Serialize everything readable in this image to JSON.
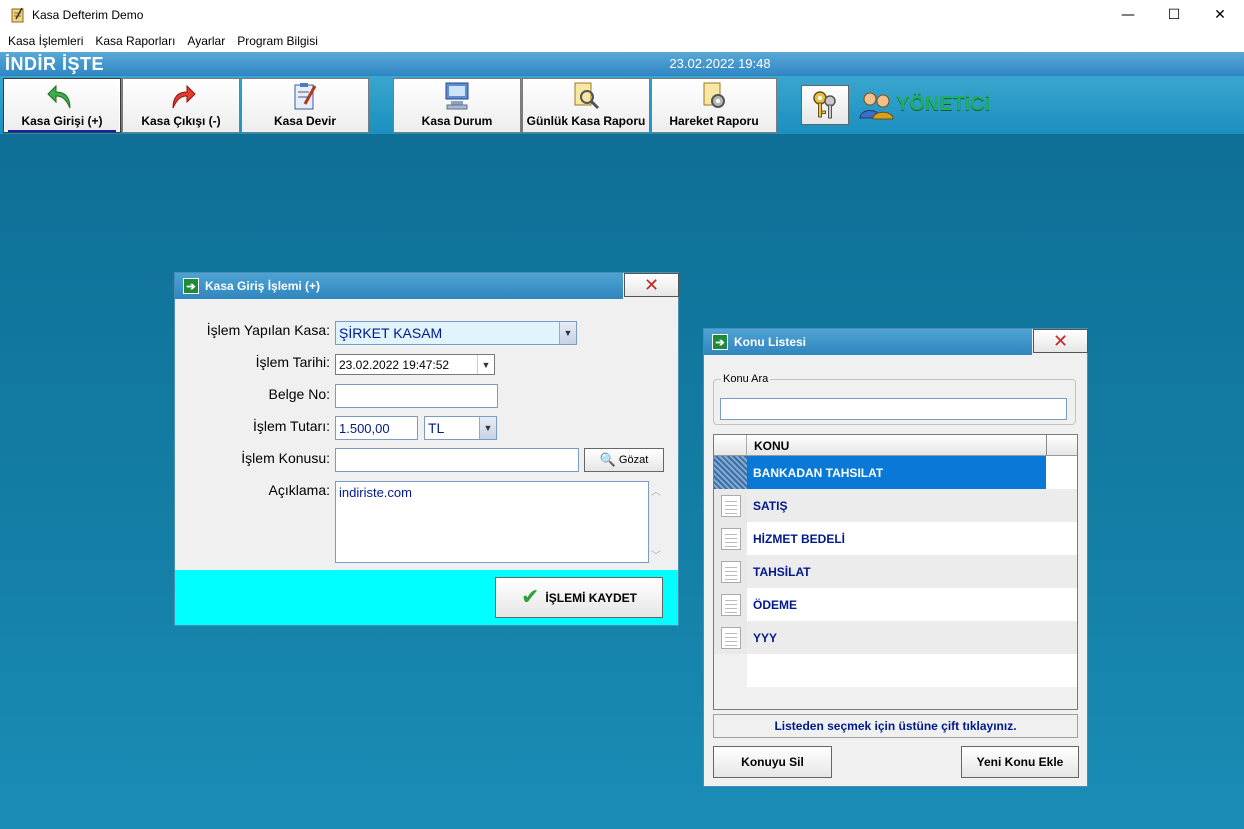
{
  "window": {
    "title": "Kasa Defterim Demo",
    "minimize": "—",
    "maximize": "☐",
    "close": "✕"
  },
  "menu": [
    "Kasa İşlemleri",
    "Kasa Raporları",
    "Ayarlar",
    "Program Bilgisi"
  ],
  "header": {
    "brand": "İNDİR İŞTE",
    "datetime": "23.02.2022 19:48"
  },
  "toolbar": {
    "kasa_girisi": "Kasa Girişi  (+)",
    "kasa_cikisi": "Kasa Çıkışı (-)",
    "kasa_devir": "Kasa Devir",
    "kasa_durum": "Kasa Durum",
    "gunluk_rapor": "Günlük Kasa Raporu",
    "hareket_raporu": "Hareket Raporu",
    "user_role": "YÖNETiCi"
  },
  "kasa_giris": {
    "title": "Kasa Giriş İşlemi (+)",
    "labels": {
      "kasa": "İşlem Yapılan Kasa:",
      "tarih": "İşlem Tarihi:",
      "belge": "Belge No:",
      "tutar": "İşlem Tutarı:",
      "konu": "İşlem Konusu:",
      "aciklama": "Açıklama:"
    },
    "values": {
      "kasa": "ŞİRKET KASAM",
      "tarih": "23.02.2022 19:47:52",
      "belge": "",
      "tutar": "1.500,00",
      "currency": "TL",
      "konu": "",
      "aciklama": "indiriste.com"
    },
    "browse_label": "Gözat",
    "save_label": "İŞLEMİ KAYDET"
  },
  "konu_listesi": {
    "title": "Konu Listesi",
    "search_legend": "Konu Ara",
    "search_value": "",
    "column": "KONU",
    "rows": [
      "BANKADAN TAHSILAT",
      "SATIŞ",
      "HİZMET BEDELİ",
      "TAHSİLAT",
      "ÖDEME",
      "YYY"
    ],
    "selected_index": 0,
    "hint": "Listeden seçmek için üstüne çift tıklayınız.",
    "delete_label": "Konuyu Sil",
    "add_label": "Yeni Konu Ekle"
  },
  "colors": {
    "workspace": "#147fa6",
    "header": "#2e86c4",
    "selection": "#0a78d7",
    "footer_cyan": "#00ffff",
    "role_green": "#1fae63"
  }
}
